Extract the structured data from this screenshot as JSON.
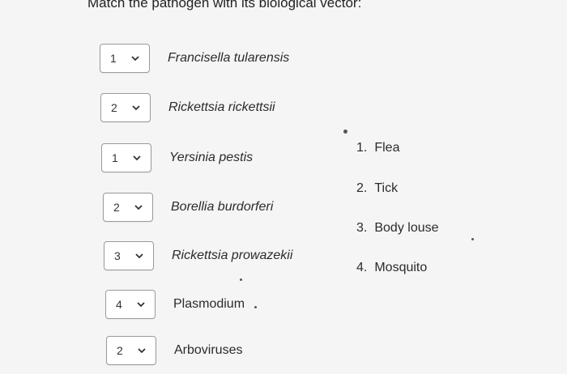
{
  "question": "Match the pathogen with its biological vector:",
  "rows": [
    {
      "selected": "1",
      "pathogen": "Francisella tularensis"
    },
    {
      "selected": "2",
      "pathogen": "Rickettsia rickettsii"
    },
    {
      "selected": "1",
      "pathogen": "Yersinia pestis"
    },
    {
      "selected": "2",
      "pathogen": "Borellia burdorferi"
    },
    {
      "selected": "3",
      "pathogen": "Rickettsia prowazekii"
    },
    {
      "selected": "4",
      "pathogen": "Plasmodium"
    },
    {
      "selected": "2",
      "pathogen": "Arboviruses"
    }
  ],
  "vectors": [
    {
      "num": "1.",
      "label": "Flea"
    },
    {
      "num": "2.",
      "label": "Tick"
    },
    {
      "num": "3.",
      "label": "Body louse"
    },
    {
      "num": "4.",
      "label": "Mosquito"
    }
  ],
  "icons": {
    "dropdown": "chevron-down-icon"
  }
}
